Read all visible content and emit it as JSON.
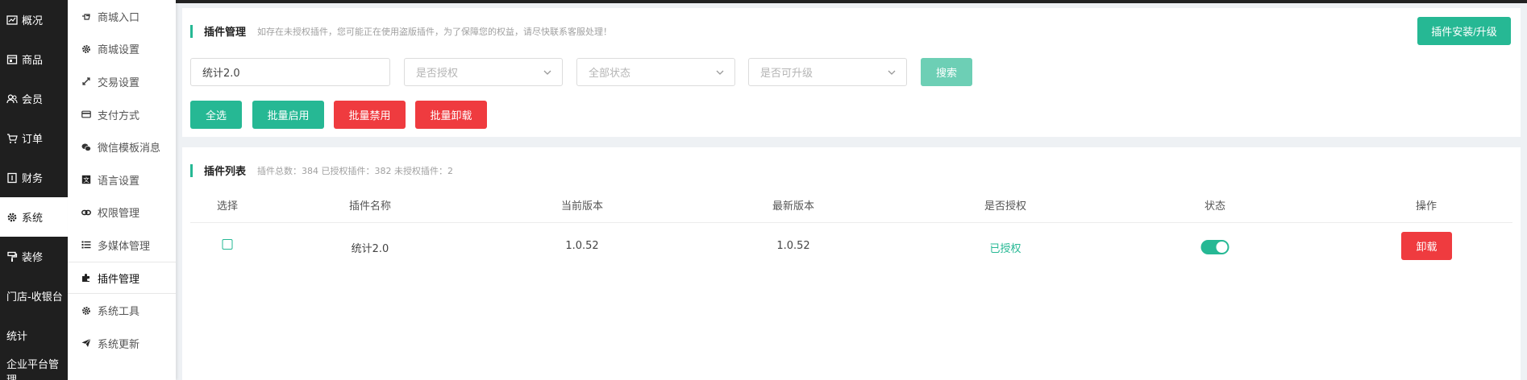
{
  "nav": {
    "items": [
      {
        "label": "概况",
        "icon": "chart-icon"
      },
      {
        "label": "商品",
        "icon": "goods-icon"
      },
      {
        "label": "会员",
        "icon": "users-icon"
      },
      {
        "label": "订单",
        "icon": "cart-icon"
      },
      {
        "label": "财务",
        "icon": "finance-icon"
      },
      {
        "label": "系统",
        "icon": "gear-icon",
        "active": true
      },
      {
        "label": "装修",
        "icon": "brush-icon"
      },
      {
        "label": "门店-收银台",
        "icon": ""
      },
      {
        "label": "统计",
        "icon": ""
      },
      {
        "label": "企业平台管理",
        "icon": ""
      }
    ]
  },
  "submenu": {
    "items": [
      {
        "label": "商城入口",
        "icon": "hand-pointer-icon"
      },
      {
        "label": "商城设置",
        "icon": "gear-icon"
      },
      {
        "label": "交易设置",
        "icon": "exchange-icon"
      },
      {
        "label": "支付方式",
        "icon": "credit-card-icon"
      },
      {
        "label": "微信模板消息",
        "icon": "wechat-icon"
      },
      {
        "label": "语言设置",
        "icon": "language-icon"
      },
      {
        "label": "权限管理",
        "icon": "link-icon"
      },
      {
        "label": "多媒体管理",
        "icon": "list-icon"
      },
      {
        "label": "插件管理",
        "icon": "puzzle-icon",
        "active": true
      },
      {
        "label": "系统工具",
        "icon": "gear-icon"
      },
      {
        "label": "系统更新",
        "icon": "paper-plane-icon"
      }
    ]
  },
  "plugin_manage": {
    "title": "插件管理",
    "desc": "如存在未授权插件，您可能正在使用盗版插件，为了保障您的权益，请尽快联系客服处理！",
    "install_button": "插件安装/升级",
    "filters": {
      "keyword_value": "统计2.0",
      "authorized_placeholder": "是否授权",
      "status_placeholder": "全部状态",
      "upgradable_placeholder": "是否可升级",
      "search_button": "搜索"
    },
    "actions": {
      "select_all": "全选",
      "batch_enable": "批量启用",
      "batch_disable": "批量禁用",
      "batch_uninstall": "批量卸载"
    }
  },
  "plugin_list": {
    "title": "插件列表",
    "stats": "插件总数：384 已授权插件：382 未授权插件：2",
    "columns": [
      "选择",
      "插件名称",
      "当前版本",
      "最新版本",
      "是否授权",
      "状态",
      "操作"
    ],
    "rows": [
      {
        "name": "统计2.0",
        "current_version": "1.0.52",
        "latest_version": "1.0.52",
        "authorized": "已授权",
        "enabled": true,
        "action": "卸载"
      }
    ]
  },
  "colors": {
    "primary": "#26b894",
    "danger": "#ef3b3f",
    "nav_bg": "#1f1f1f"
  }
}
